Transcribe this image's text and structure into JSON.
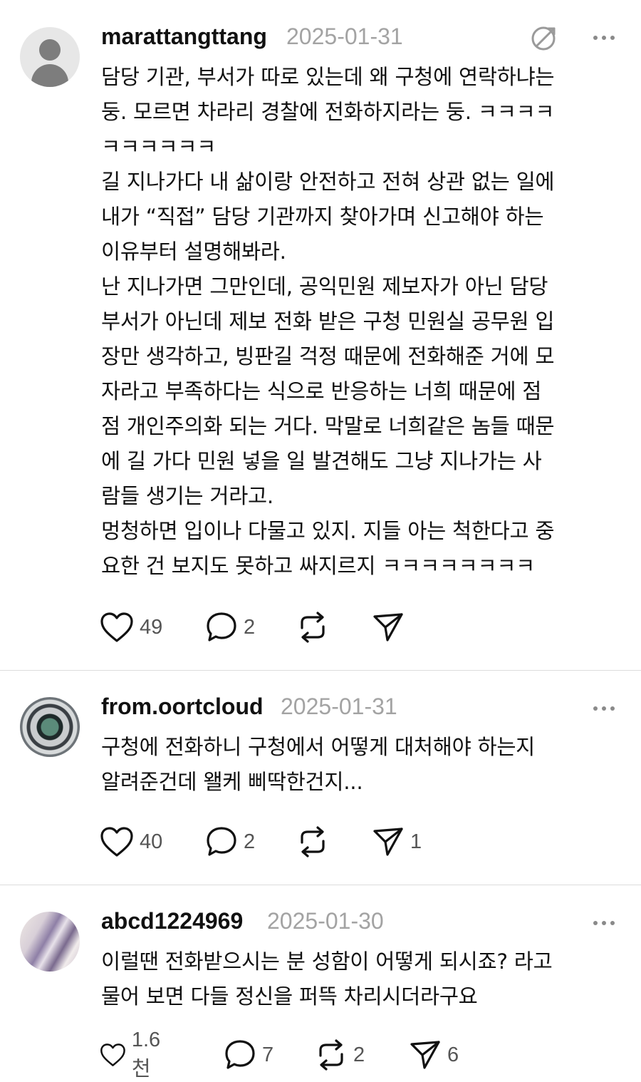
{
  "posts": [
    {
      "username": "marattangttang",
      "date": "2025-01-31",
      "text": "담당 기관, 부서가 따로 있는데 왜 구청에 연락하냐는\n둥. 모르면 차라리 경찰에 전화하지라는 둥. ㅋㅋㅋㅋ\nㅋㅋㅋㅋㅋㅋ\n길 지나가다 내 삶이랑 안전하고 전혀 상관 없는 일에\n내가 “직접” 담당 기관까지 찾아가며 신고해야 하는\n이유부터 설명해봐라.\n난 지나가면 그만인데, 공익민원 제보자가 아닌 담당\n부서가 아닌데 제보 전화 받은 구청 민원실 공무원 입\n장만 생각하고, 빙판길 걱정 때문에 전화해준 거에 모\n자라고 부족하다는 식으로 반응하는 너희 때문에 점\n점 개인주의화 되는 거다. 막말로 너희같은 놈들 때문\n에 길 가다 민원 넣을 일 발견해도 그냥 지나가는 사\n람들 생기는 거라고.\n멍청하면 입이나 다물고 있지. 지들 아는 척한다고 중\n요한 건 보지도 못하고 싸지르지 ㅋㅋㅋㅋㅋㅋㅋㅋ",
      "likes": "49",
      "comments": "2",
      "reposts": "",
      "shares": "",
      "avatar_icon": "default-user-icon"
    },
    {
      "username": "from.oortcloud",
      "date": "2025-01-31",
      "text": "구청에 전화하니 구청에서 어떻게 대처해야 하는지\n알려준건데 왤케 삐딱한건지...",
      "likes": "40",
      "comments": "2",
      "reposts": "",
      "shares": "1",
      "avatar_icon": "lens-avatar"
    },
    {
      "username": "abcd1224969",
      "date": "2025-01-30",
      "text": "이럴땐 전화받으시는 분 성함이 어떻게 되시죠? 라고\n물어 보면 다들 정신을 퍼뜩 차리시더라구요",
      "likes": "1.6천",
      "comments": "7",
      "reposts": "2",
      "shares": "6",
      "avatar_icon": "photo-avatar"
    }
  ],
  "icons": {
    "like": "heart-icon",
    "comment": "comment-bubble-icon",
    "repost": "repost-icon",
    "share": "send-icon",
    "more": "more-dots-icon",
    "edit": "edit-icon"
  }
}
